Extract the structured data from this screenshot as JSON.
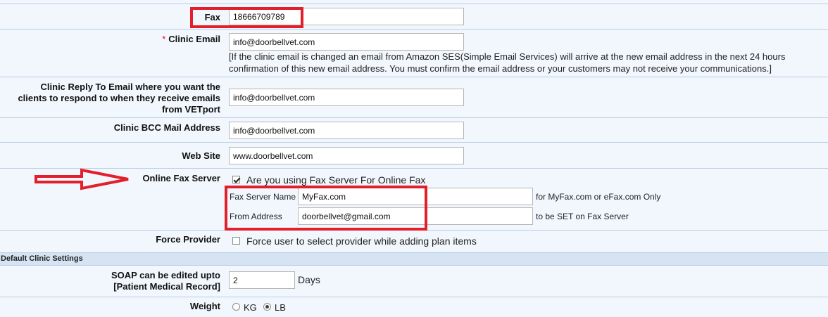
{
  "fax": {
    "label": "Fax",
    "value": "18666709789"
  },
  "clinic_email": {
    "required_mark": "*",
    "label": "Clinic Email",
    "value": "info@doorbellvet.com",
    "note_line1": "[If the clinic email is changed an email from Amazon SES(Simple Email Services) will arrive at the new email address in the next 24 hours",
    "note_line2": "confirmation of this new email address. You must confirm the email address or your customers may not receive your communications.]"
  },
  "reply_to": {
    "label_line1": "Clinic Reply To Email where you want the",
    "label_line2": "clients to respond to when they receive emails",
    "label_line3": "from VETport",
    "value": "info@doorbellvet.com"
  },
  "bcc": {
    "label": "Clinic BCC Mail Address",
    "value": "info@doorbellvet.com"
  },
  "website": {
    "label": "Web Site",
    "value": "www.doorbellvet.com"
  },
  "online_fax": {
    "label": "Online Fax Server",
    "checkbox_label": "Are you using Fax Server For Online Fax",
    "checked": true,
    "server_name_label": "Fax Server Name",
    "server_name_value": "MyFax.com",
    "server_name_hint": "for MyFax.com or eFax.com Only",
    "from_address_label": "From Address",
    "from_address_value": "doorbellvet@gmail.com",
    "from_address_hint": "to be SET on Fax Server"
  },
  "force_provider": {
    "label": "Force Provider",
    "checkbox_label": "Force user to select provider while adding plan items",
    "checked": false
  },
  "section_title": "Default Clinic Settings",
  "soap": {
    "label_line1": "SOAP can be edited upto",
    "label_line2": "[Patient Medical Record]",
    "value": "2",
    "unit": "Days"
  },
  "weight": {
    "label": "Weight",
    "options": [
      "KG",
      "LB"
    ],
    "selected": "LB"
  },
  "colors": {
    "annotation_red": "#e21f2b",
    "row_bg": "#f2f7fd",
    "border": "#b9cde6"
  }
}
